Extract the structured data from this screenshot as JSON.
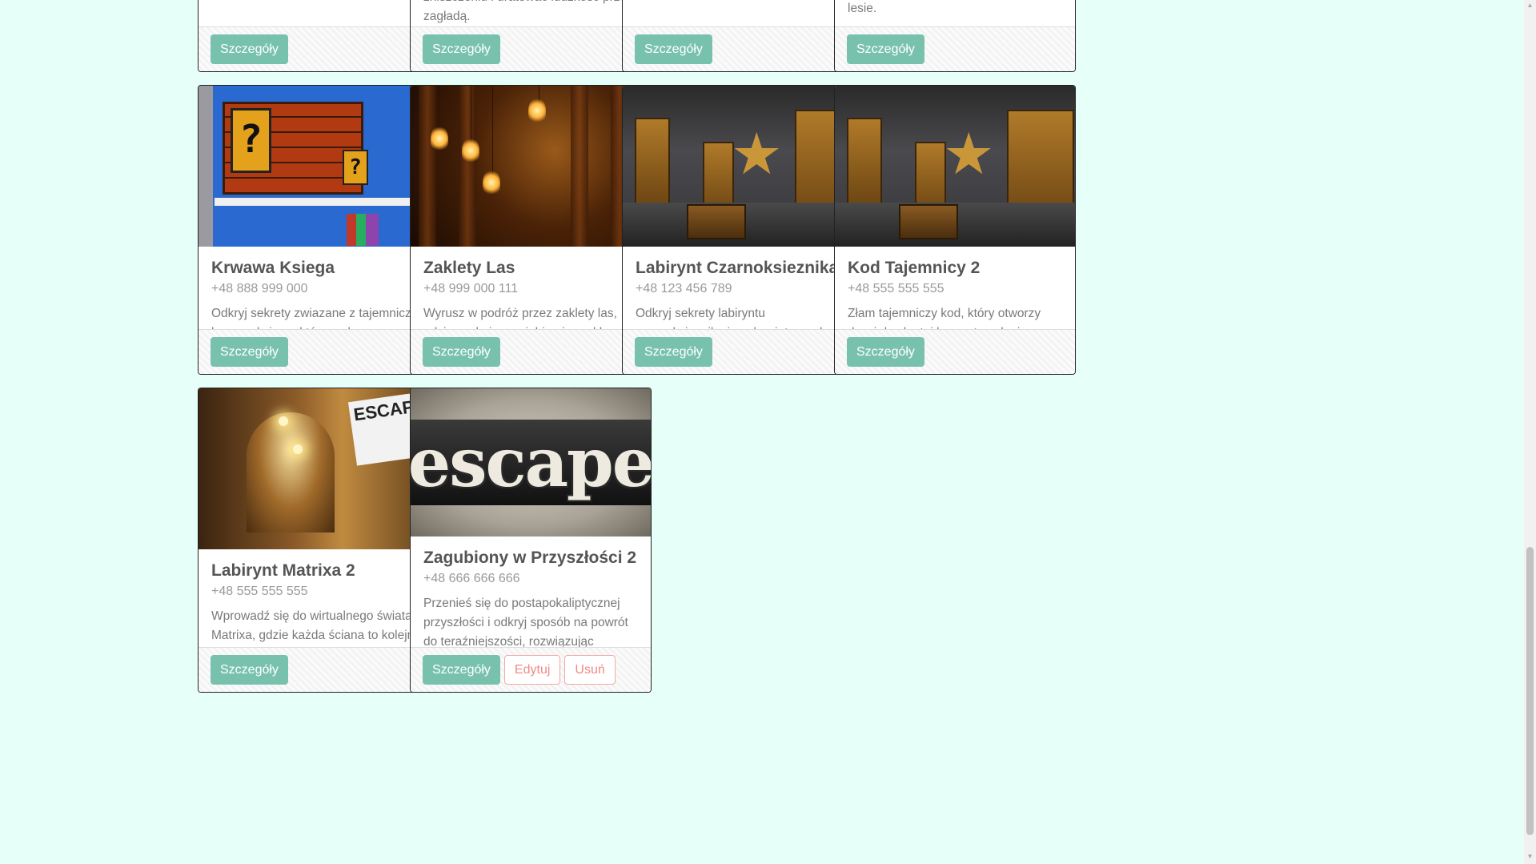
{
  "colors": {
    "background": "#e6fff9",
    "primary": "#78c2ad",
    "danger": "#f08b84"
  },
  "top_row": [
    {
      "desc_tail": "",
      "button": "Szczegóły"
    },
    {
      "desc_tail": "zniszczeniu i uratować ludzkość przed zagładą.",
      "button": "Szczegóły"
    },
    {
      "desc_tail": "",
      "button": "Szczegóły"
    },
    {
      "desc_tail": "lesie.",
      "button": "Szczegóły"
    }
  ],
  "cards": [
    {
      "title": "Krwawa Ksiega",
      "phone": "+48 888 999 000",
      "description": "Odkryj sekrety zwiazane z tajemnicza krwawa ksiega, która rzekomo przynosi nieszczescie kazdemu, kto ja dotknie.",
      "image": "mario-room-image",
      "button": "Szczegóły"
    },
    {
      "title": "Zaklety Las",
      "phone": "+48 999 000 111",
      "description": "Wyrusz w podróż przez zaklety las, gdzie czekaja na ciebie niezwykle stworzenia i tajemnicze artefakty.",
      "image": "lightbulbs-room-image",
      "button": "Szczegóły"
    },
    {
      "title": "Labirynt Czarnoksieznika",
      "phone": "+48 123 456 789",
      "description": "Odkryj sekrety labiryntu czarnoksieznika i ocal swiat przed ciemnoscia, która grozi zniszczeniem.",
      "image": "star-room-image",
      "button": "Szczegóły"
    },
    {
      "title": "Kod Tajemnicy 2",
      "phone": "+48 555 555 555",
      "description": "Złam tajemniczy kod, który otworzy drzwi do skrytej komnaty pełnej ukrytych skarbów. Czy potrafisz rozszyfrować wszystkie znaki?",
      "image": "star-room-image",
      "button": "Szczegóły"
    },
    {
      "title": "Labirynt Matrixa 2",
      "phone": "+48 555 555 555",
      "description": "Wprowadź się do wirtualnego świata Matrixa, gdzie każda ściana to kolejna warstwa kodu. Czy potrafisz znaleźć wyjście z tego cyber-labiryntu?",
      "image": "tunnel-room-image",
      "image_text": "ESCAPE",
      "button": "Szczegóły"
    },
    {
      "title": "Zagubiony w Przyszłości 2",
      "phone": "+48 666 666 666",
      "description": "Przenieś się do postapokaliptycznej przyszłości i odkryj sposób na powrót do teraźniejszości, rozwiązując enigmatyczne łamigłówki.",
      "image": "escape-letterpress-image",
      "image_text": "escape",
      "button": "Szczegóły",
      "edit_button": "Edytuj",
      "delete_button": "Usuń"
    }
  ]
}
